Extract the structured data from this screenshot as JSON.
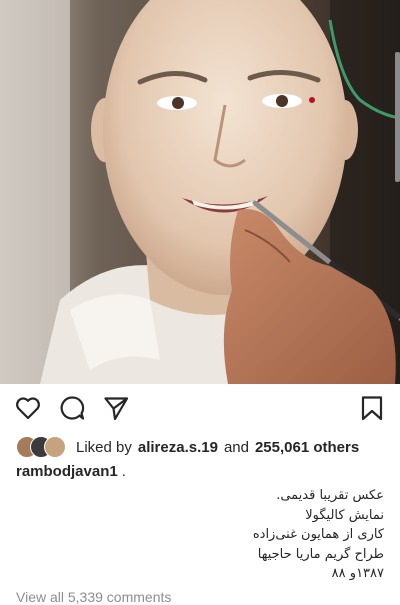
{
  "post": {
    "likes": {
      "prefix": "Liked by",
      "user": "alireza.s.19",
      "and": "and",
      "count": "255,061 others"
    },
    "username": "rambodjavan1",
    "username_suffix": ".",
    "caption_lines": [
      "عکس تقریبا قدیمی.",
      "نمایش کالیگولا",
      "کاری از همایون غنی‌زاده",
      "طراح گریم ماریا حاجیها",
      "۱۳۸۷و ۸۸"
    ],
    "comments_link": "View all 5,339 comments"
  },
  "icons": {
    "like": "heart-icon",
    "comment": "comment-icon",
    "share": "send-icon",
    "save": "bookmark-icon"
  },
  "colors": {
    "text": "#262626",
    "muted": "#8e8e8e"
  }
}
